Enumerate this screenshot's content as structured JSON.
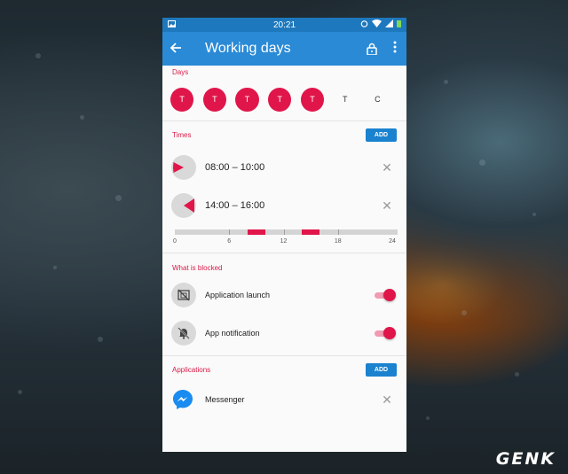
{
  "status_bar": {
    "time": "20:21",
    "icons": [
      "image-icon",
      "alarm-icon",
      "wifi-icon",
      "signal-icon",
      "battery-icon"
    ]
  },
  "app_bar": {
    "title": "Working days",
    "icons": [
      "back-arrow-icon",
      "lock-icon",
      "more-vert-icon"
    ]
  },
  "days": {
    "label": "Days",
    "items": [
      {
        "letter": "T",
        "active": true
      },
      {
        "letter": "T",
        "active": true
      },
      {
        "letter": "T",
        "active": true
      },
      {
        "letter": "T",
        "active": true
      },
      {
        "letter": "T",
        "active": true
      },
      {
        "letter": "T",
        "active": false
      },
      {
        "letter": "C",
        "active": false
      }
    ]
  },
  "times": {
    "label": "Times",
    "add_label": "ADD",
    "entries": [
      {
        "range": "08:00 – 10:00"
      },
      {
        "range": "14:00 – 16:00"
      }
    ],
    "timeline": {
      "ticks": [
        "0",
        "6",
        "12",
        "18",
        "24"
      ],
      "segments": [
        [
          8,
          10
        ],
        [
          14,
          16
        ]
      ]
    }
  },
  "blocked": {
    "label": "What is blocked",
    "items": [
      {
        "label": "Application launch",
        "enabled": true,
        "icon": "app-launch-blocked-icon"
      },
      {
        "label": "App notification",
        "enabled": true,
        "icon": "notification-off-icon"
      }
    ]
  },
  "applications": {
    "label": "Applications",
    "add_label": "ADD",
    "items": [
      {
        "label": "Messenger",
        "icon": "messenger-icon"
      }
    ]
  },
  "watermark": "GENK",
  "colors": {
    "primary": "#2a8ad6",
    "status": "#1e78bd",
    "accent": "#e0164a",
    "button": "#1a82cf"
  }
}
